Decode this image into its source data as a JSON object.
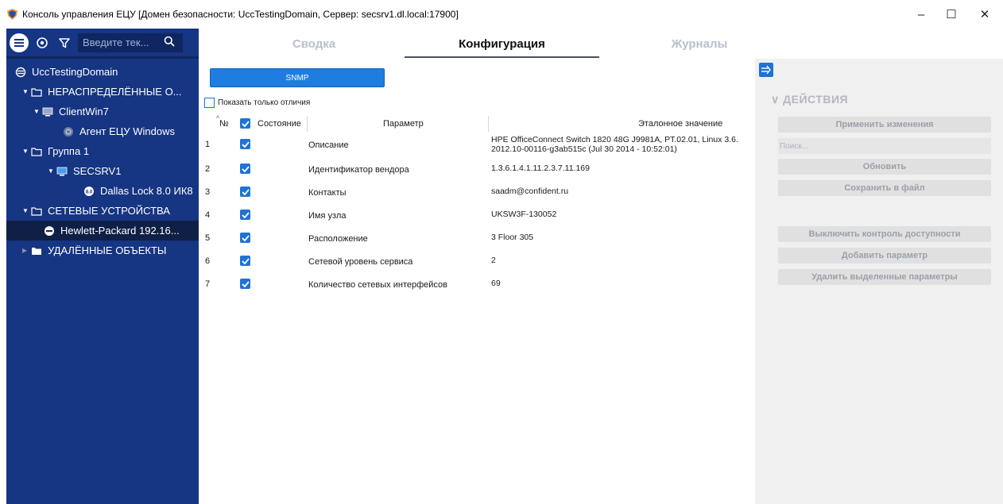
{
  "window": {
    "title": "Консоль управления ЕЦУ [Домен безопасности: UccTestingDomain, Сервер: secsrv1.dl.local:17900]",
    "minimize": "–",
    "maximize": "☐",
    "close": "✕"
  },
  "sidebar": {
    "search_placeholder": "Введите тек...",
    "tree": [
      {
        "label": "UccTestingDomain",
        "icon": "domain-icon"
      },
      {
        "label": "НЕРАСПРЕДЕЛЁННЫЕ О...",
        "icon": "folder-icon"
      },
      {
        "label": "ClientWin7",
        "icon": "computer-icon"
      },
      {
        "label": "Агент ЕЦУ Windows",
        "icon": "agent-icon"
      },
      {
        "label": "Группа 1",
        "icon": "folder-icon"
      },
      {
        "label": "SECSRV1",
        "icon": "computer-icon"
      },
      {
        "label": "Dallas Lock 8.0 ИК8",
        "icon": "dallas-lock-icon"
      },
      {
        "label": "СЕТЕВЫЕ УСТРОЙСТВА",
        "icon": "folder-icon"
      },
      {
        "label": "Hewlett-Packard 192.16...",
        "icon": "network-device-icon"
      },
      {
        "label": "УДАЛЁННЫЕ ОБЪЕКТЫ",
        "icon": "folder-filled-icon"
      }
    ]
  },
  "tabs": [
    "Сводка",
    "Конфигурация",
    "Журналы"
  ],
  "active_tab": "Конфигурация",
  "main": {
    "snmp_label": "SNMP",
    "show_diff_label": "Показать только отличия",
    "columns": {
      "num": "№",
      "state": "Состояние",
      "param": "Параметр",
      "ref": "Эталонное значение"
    },
    "rows": [
      {
        "num": "1",
        "param": "Описание",
        "ref": "HPE OfficeConnect Switch 1820 48G J9981A, PT.02.01, Linux 3.6.",
        "ref2": "2012.10-00116-g3ab515c (Jul 30 2014 - 10:52:01)"
      },
      {
        "num": "2",
        "param": "Идентификатор вендора",
        "ref": "1.3.6.1.4.1.11.2.3.7.11.169",
        "ref2": ""
      },
      {
        "num": "3",
        "param": "Контакты",
        "ref": "saadm@confident.ru",
        "ref2": ""
      },
      {
        "num": "4",
        "param": "Имя узла",
        "ref": "UKSW3F-130052",
        "ref2": ""
      },
      {
        "num": "5",
        "param": "Расположение",
        "ref": "3 Floor 305",
        "ref2": ""
      },
      {
        "num": "6",
        "param": "Сетевой уровень сервиса",
        "ref": "2",
        "ref2": ""
      },
      {
        "num": "7",
        "param": "Количество сетевых интерфейсов",
        "ref": "69",
        "ref2": ""
      }
    ]
  },
  "actions": {
    "title": "ДЕЙСТВИЯ",
    "apply": "Применить изменения",
    "search_placeholder": "Поиск...",
    "refresh": "Обновить",
    "save": "Сохранить в файл",
    "disable_control": "Выключить контроль доступности",
    "add_param": "Добавить параметр",
    "delete_params": "Удалить выделенные параметры"
  },
  "colors": {
    "sidebar_bg": "#163582",
    "accent": "#1f72d8",
    "panel_bg": "#f0f0f0"
  }
}
